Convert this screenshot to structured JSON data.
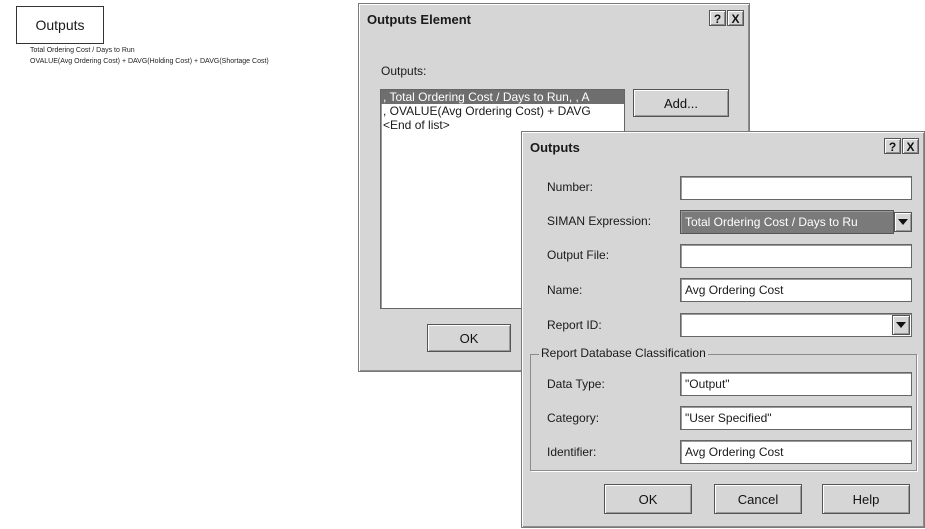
{
  "module": {
    "title": "Outputs",
    "lines": [
      "Total Ordering Cost / Days to Run",
      "OVALUE(Avg Ordering Cost) + DAVG(Holding Cost) + DAVG(Shortage Cost)"
    ]
  },
  "element_dialog": {
    "title": "Outputs Element",
    "help_btn": "?",
    "close_btn": "X",
    "outputs_label": "Outputs:",
    "list": [
      ", Total Ordering Cost / Days to Run, , A",
      ", OVALUE(Avg Ordering Cost) + DAVG",
      "<End of list>"
    ],
    "add_button": "Add...",
    "ok_button": "OK"
  },
  "outputs_dialog": {
    "title": "Outputs",
    "help_btn": "?",
    "close_btn": "X",
    "fields": {
      "number": {
        "label": "Number:",
        "value": ""
      },
      "siman_expression": {
        "label": "SIMAN Expression:",
        "value": "Total Ordering Cost / Days to Ru"
      },
      "output_file": {
        "label": "Output File:",
        "value": ""
      },
      "name": {
        "label": "Name:",
        "value": "Avg Ordering Cost"
      },
      "report_id": {
        "label": "Report ID:",
        "value": ""
      }
    },
    "group": {
      "title": "Report Database Classification",
      "data_type": {
        "label": "Data Type:",
        "value": "\"Output\""
      },
      "category": {
        "label": "Category:",
        "value": "\"User Specified\""
      },
      "identifier": {
        "label": "Identifier:",
        "value": "Avg Ordering Cost"
      }
    },
    "buttons": {
      "ok": "OK",
      "cancel": "Cancel",
      "help": "Help"
    }
  },
  "colors": {
    "dialog_face": "#d6d6d6",
    "selection": "#6e6e6e",
    "disabled_field": "#7a7a7a"
  },
  "icons": [
    "chevron-down-icon",
    "question-icon",
    "close-icon"
  ]
}
